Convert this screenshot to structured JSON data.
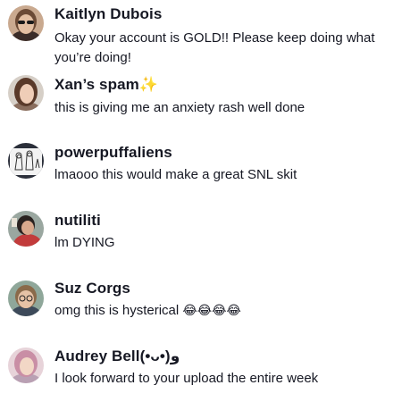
{
  "comments": [
    {
      "username": "Kaitlyn Dubois",
      "text": "Okay your account is GOLD!! Please keep doing what you’re doing!",
      "avatar": "woman-with-sunglasses-avatar"
    },
    {
      "username": "Xan’s spam",
      "username_emoji": "✨",
      "text": "this is giving me an anxiety rash well done",
      "avatar": "woman-portrait-avatar"
    },
    {
      "username": "powerpuffaliens",
      "text": "lmaooo this would make a great SNL skit",
      "avatar": "cartoon-sketch-avatar"
    },
    {
      "username": "nutiliti",
      "text": "lm DYING",
      "avatar": "person-red-shirt-avatar"
    },
    {
      "username": "Suz Corgs",
      "text": "omg this is hysterical",
      "text_emoji": "😂😂😂😂",
      "avatar": "person-glasses-avatar"
    },
    {
      "username": "Audrey Bell(•ᴗ•)و",
      "text": "I look forward to your upload the entire week",
      "avatar": "woman-pink-hair-avatar"
    }
  ]
}
